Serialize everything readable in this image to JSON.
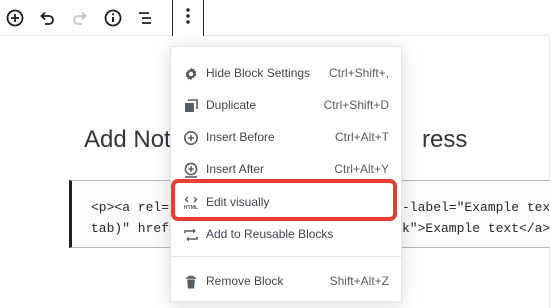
{
  "toolbar": {
    "add_block": "add-block-icon",
    "undo": "undo-icon",
    "redo": "redo-icon",
    "info": "info-icon",
    "navigation": "block-navigation-icon",
    "more": "more-options-icon"
  },
  "editor": {
    "heading_visible_left": "Add Not",
    "heading_visible_right": "ress",
    "code_line_1_left": "<p><a rel=\"",
    "code_line_1_right": "-label=\"Example text",
    "code_line_2_left": "tab)\" href=",
    "code_line_2_right": "k\">Example text</a></"
  },
  "block_menu": {
    "items": [
      {
        "icon": "gear-icon",
        "label": "Hide Block Settings",
        "shortcut": "Ctrl+Shift+,"
      },
      {
        "icon": "duplicate-icon",
        "label": "Duplicate",
        "shortcut": "Ctrl+Shift+D"
      },
      {
        "icon": "insert-before-icon",
        "label": "Insert Before",
        "shortcut": "Ctrl+Alt+T"
      },
      {
        "icon": "insert-after-icon",
        "label": "Insert After",
        "shortcut": "Ctrl+Alt+Y"
      },
      {
        "icon": "html-icon",
        "label": "Edit visually",
        "shortcut": ""
      },
      {
        "icon": "reusable-block-icon",
        "label": "Add to Reusable Blocks",
        "shortcut": ""
      },
      {
        "icon": "trash-icon",
        "label": "Remove Block",
        "shortcut": "Shift+Alt+Z"
      }
    ]
  },
  "colors": {
    "highlight_border": "#e63e2f",
    "menu_text": "#40464d",
    "icon": "#555d66"
  }
}
